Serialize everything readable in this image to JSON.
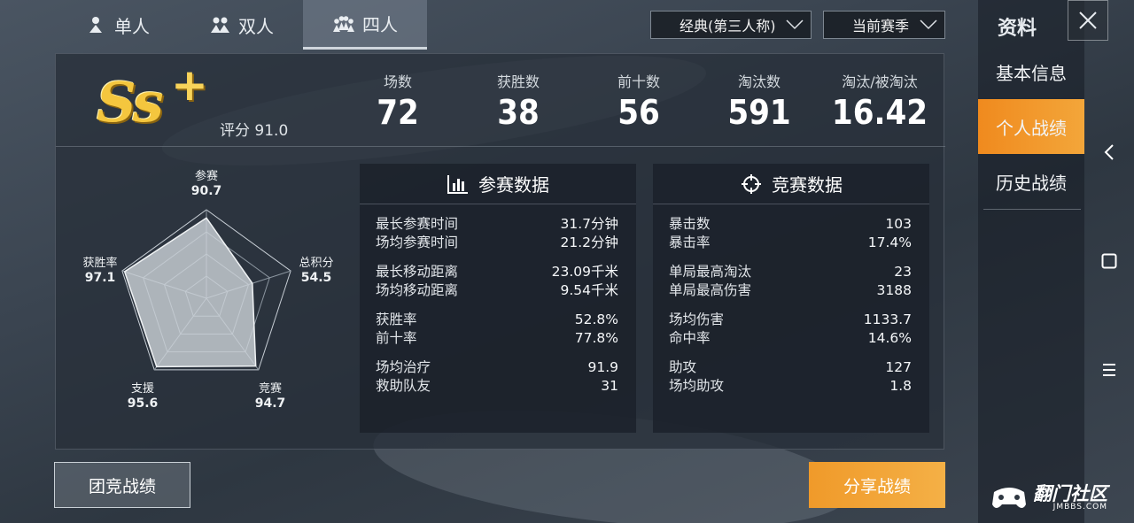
{
  "mode_tabs": [
    {
      "label": "单人",
      "active": false
    },
    {
      "label": "双人",
      "active": false
    },
    {
      "label": "四人",
      "active": true
    }
  ],
  "filters": {
    "perspective": "经典(第三人称)",
    "season": "当前赛季"
  },
  "summary": {
    "rank": "Ss",
    "rank_plus": "+",
    "score_label": "评分",
    "score_value": "91.0",
    "stats": [
      {
        "label": "场数",
        "value": "72"
      },
      {
        "label": "获胜数",
        "value": "38"
      },
      {
        "label": "前十数",
        "value": "56"
      },
      {
        "label": "淘汰数",
        "value": "591"
      },
      {
        "label": "淘汰/被淘汰",
        "value": "16.42"
      }
    ]
  },
  "radar": {
    "axes": [
      {
        "label": "参赛",
        "value": "90.7",
        "score": 90.7
      },
      {
        "label": "总积分",
        "value": "54.5",
        "score": 54.5
      },
      {
        "label": "竞赛",
        "value": "94.7",
        "score": 94.7
      },
      {
        "label": "支援",
        "value": "95.6",
        "score": 95.6
      },
      {
        "label": "获胜率",
        "value": "97.1",
        "score": 97.1
      }
    ]
  },
  "participation": {
    "title": "参赛数据",
    "groups": [
      [
        {
          "label": "最长参赛时间",
          "value": "31.7分钟"
        },
        {
          "label": "场均参赛时间",
          "value": "21.2分钟"
        }
      ],
      [
        {
          "label": "最长移动距离",
          "value": "23.09千米"
        },
        {
          "label": "场均移动距离",
          "value": "9.54千米"
        }
      ],
      [
        {
          "label": "获胜率",
          "value": "52.8%"
        },
        {
          "label": "前十率",
          "value": "77.8%"
        }
      ],
      [
        {
          "label": "场均治疗",
          "value": "91.9"
        },
        {
          "label": "救助队友",
          "value": "31"
        }
      ]
    ]
  },
  "competition": {
    "title": "竞赛数据",
    "groups": [
      [
        {
          "label": "暴击数",
          "value": "103"
        },
        {
          "label": "暴击率",
          "value": "17.4%"
        }
      ],
      [
        {
          "label": "单局最高淘汰",
          "value": "23"
        },
        {
          "label": "单局最高伤害",
          "value": "3188"
        }
      ],
      [
        {
          "label": "场均伤害",
          "value": "1133.7"
        },
        {
          "label": "命中率",
          "value": "14.6%"
        }
      ],
      [
        {
          "label": "助攻",
          "value": "127"
        },
        {
          "label": "场均助攻",
          "value": "1.8"
        }
      ]
    ]
  },
  "buttons": {
    "team": "团竞战绩",
    "share": "分享战绩"
  },
  "side_panel": {
    "title": "资料",
    "items": [
      {
        "label": "基本信息",
        "active": false
      },
      {
        "label": "个人战绩",
        "active": true
      },
      {
        "label": "历史战绩",
        "active": false
      }
    ]
  },
  "watermark": {
    "main": "翻门社区",
    "sub": "JMBBS.COM"
  },
  "colors": {
    "accent_orange": "#f09a2a",
    "rank_gold": "#f4c63e",
    "panel_bg": "#28303a"
  }
}
